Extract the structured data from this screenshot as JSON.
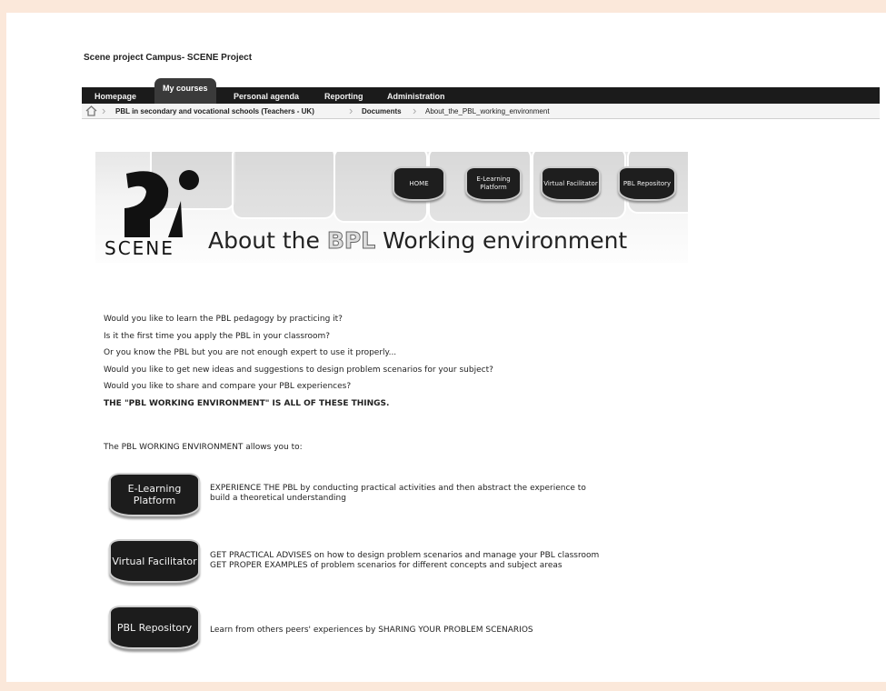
{
  "site": {
    "title": "Scene project Campus- SCENE Project"
  },
  "nav": {
    "homepage": "Homepage",
    "my_courses": "My courses",
    "personal_agenda": "Personal agenda",
    "reporting": "Reporting",
    "administration": "Administration"
  },
  "breadcrumb": [
    "PBL in secondary and vocational schools (Teachers - UK)",
    "Documents",
    "About_the_PBL_working_environment"
  ],
  "banner": {
    "logo_text": "SCENE",
    "title_pre": "About the ",
    "title_highlight": "BPL",
    "title_post": " Working environment",
    "buttons": [
      {
        "label": "HOME"
      },
      {
        "label": "E-Learning Platform"
      },
      {
        "label": "Virtual Facilitator"
      },
      {
        "label": "PBL Repository"
      }
    ]
  },
  "intro": [
    "Would you like to learn the PBL pedagogy by practicing it?",
    "Is it the first time you apply the PBL in your classroom?",
    "Or you know the PBL but you are not enough expert to use it properly...",
    "Would you like to get new ideas and suggestions to design problem scenarios for your subject?",
    "Would you like to share and compare your PBL   experiences?",
    "THE \"PBL WORKING ENVIRONMENT\" IS ALL OF THESE THINGS."
  ],
  "allows": "The PBL WORKING ENVIRONMENT allows you to:",
  "features": [
    {
      "button": "E-Learning Platform",
      "lines": [
        "EXPERIENCE THE PBL by conducting practical activities and then abstract the experience to",
        "build a theoretical understanding"
      ]
    },
    {
      "button": "Virtual Facilitator",
      "lines": [
        "GET PRACTICAL ADVISES on how to design problem scenarios and manage your PBL classroom",
        "GET PROPER EXAMPLES of problem scenarios for different concepts and subject areas"
      ]
    },
    {
      "button": "PBL Repository",
      "lines": [
        "Learn from others peers' experiences by SHARING YOUR PROBLEM SCENARIOS"
      ]
    }
  ],
  "colors": {
    "navbar": "#1b1b1b",
    "page_border": "#fbe8da",
    "button": "#1c1c1c"
  }
}
